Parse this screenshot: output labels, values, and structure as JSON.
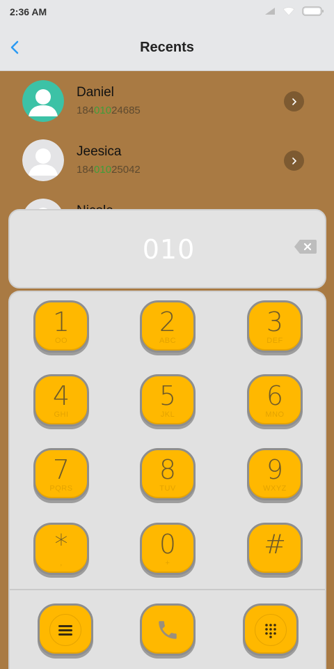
{
  "status": {
    "time": "2:36 AM"
  },
  "header": {
    "title": "Recents"
  },
  "contacts": [
    {
      "name": "Daniel",
      "number_pre": "184",
      "number_match": "010",
      "number_post": "24685"
    },
    {
      "name": "Jeesica",
      "number_pre": "184",
      "number_match": "010",
      "number_post": "25042"
    },
    {
      "name": "Nicole",
      "number_pre": "",
      "number_match": "",
      "number_post": ""
    }
  ],
  "dialer": {
    "input": "010",
    "keys": [
      {
        "digit": "1",
        "sub": "OO"
      },
      {
        "digit": "2",
        "sub": "ABC"
      },
      {
        "digit": "3",
        "sub": "DEF"
      },
      {
        "digit": "4",
        "sub": "GHI"
      },
      {
        "digit": "5",
        "sub": "JKL"
      },
      {
        "digit": "6",
        "sub": "MNO"
      },
      {
        "digit": "7",
        "sub": "PQRS"
      },
      {
        "digit": "8",
        "sub": "TUV"
      },
      {
        "digit": "9",
        "sub": "WXYZ"
      },
      {
        "digit": "*",
        "sub": ","
      },
      {
        "digit": "0",
        "sub": "+"
      },
      {
        "digit": "#",
        "sub": ""
      }
    ]
  },
  "icons": {
    "menu": "menu-icon",
    "call": "phone-icon",
    "dialpad": "dialpad-icon",
    "back": "chevron-left-icon",
    "backspace": "backspace-icon"
  },
  "colors": {
    "background": "#a97a43",
    "key": "#ffb800",
    "accent_blue": "#2b9af3",
    "match_green": "#3f9d3b",
    "avatar_teal": "#3cc2a6"
  }
}
